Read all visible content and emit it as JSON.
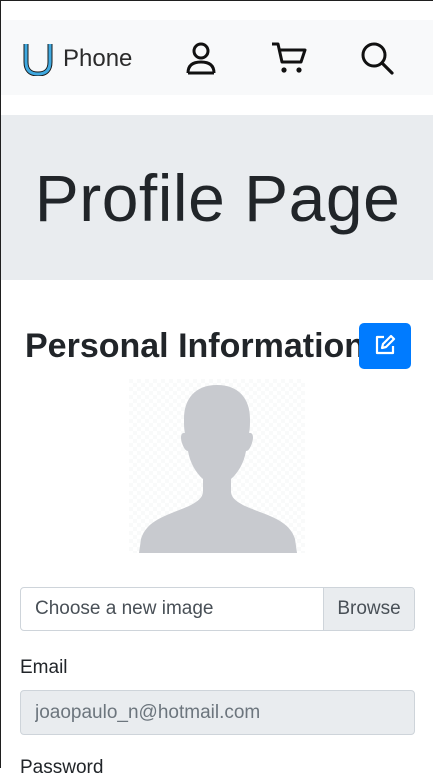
{
  "navbar": {
    "brand_text": "Phone",
    "icons": [
      "u-logo-icon",
      "user-icon",
      "cart-icon",
      "search-icon"
    ]
  },
  "jumbotron": {
    "title": "Profile Page"
  },
  "profile": {
    "section_title": "Personal Information",
    "edit_icon": "edit-icon",
    "avatar_icon": "avatar-silhouette-icon",
    "file_input": {
      "placeholder": "Choose a new image",
      "browse_label": "Browse"
    },
    "email": {
      "label": "Email",
      "value": "joaopaulo_n@hotmail.com"
    },
    "password": {
      "label": "Password"
    }
  },
  "colors": {
    "primary": "#007bff",
    "navbar_bg": "#f8f9fa",
    "jumbotron_bg": "#e9ecef",
    "logo_fill": "#3fa9e0"
  }
}
